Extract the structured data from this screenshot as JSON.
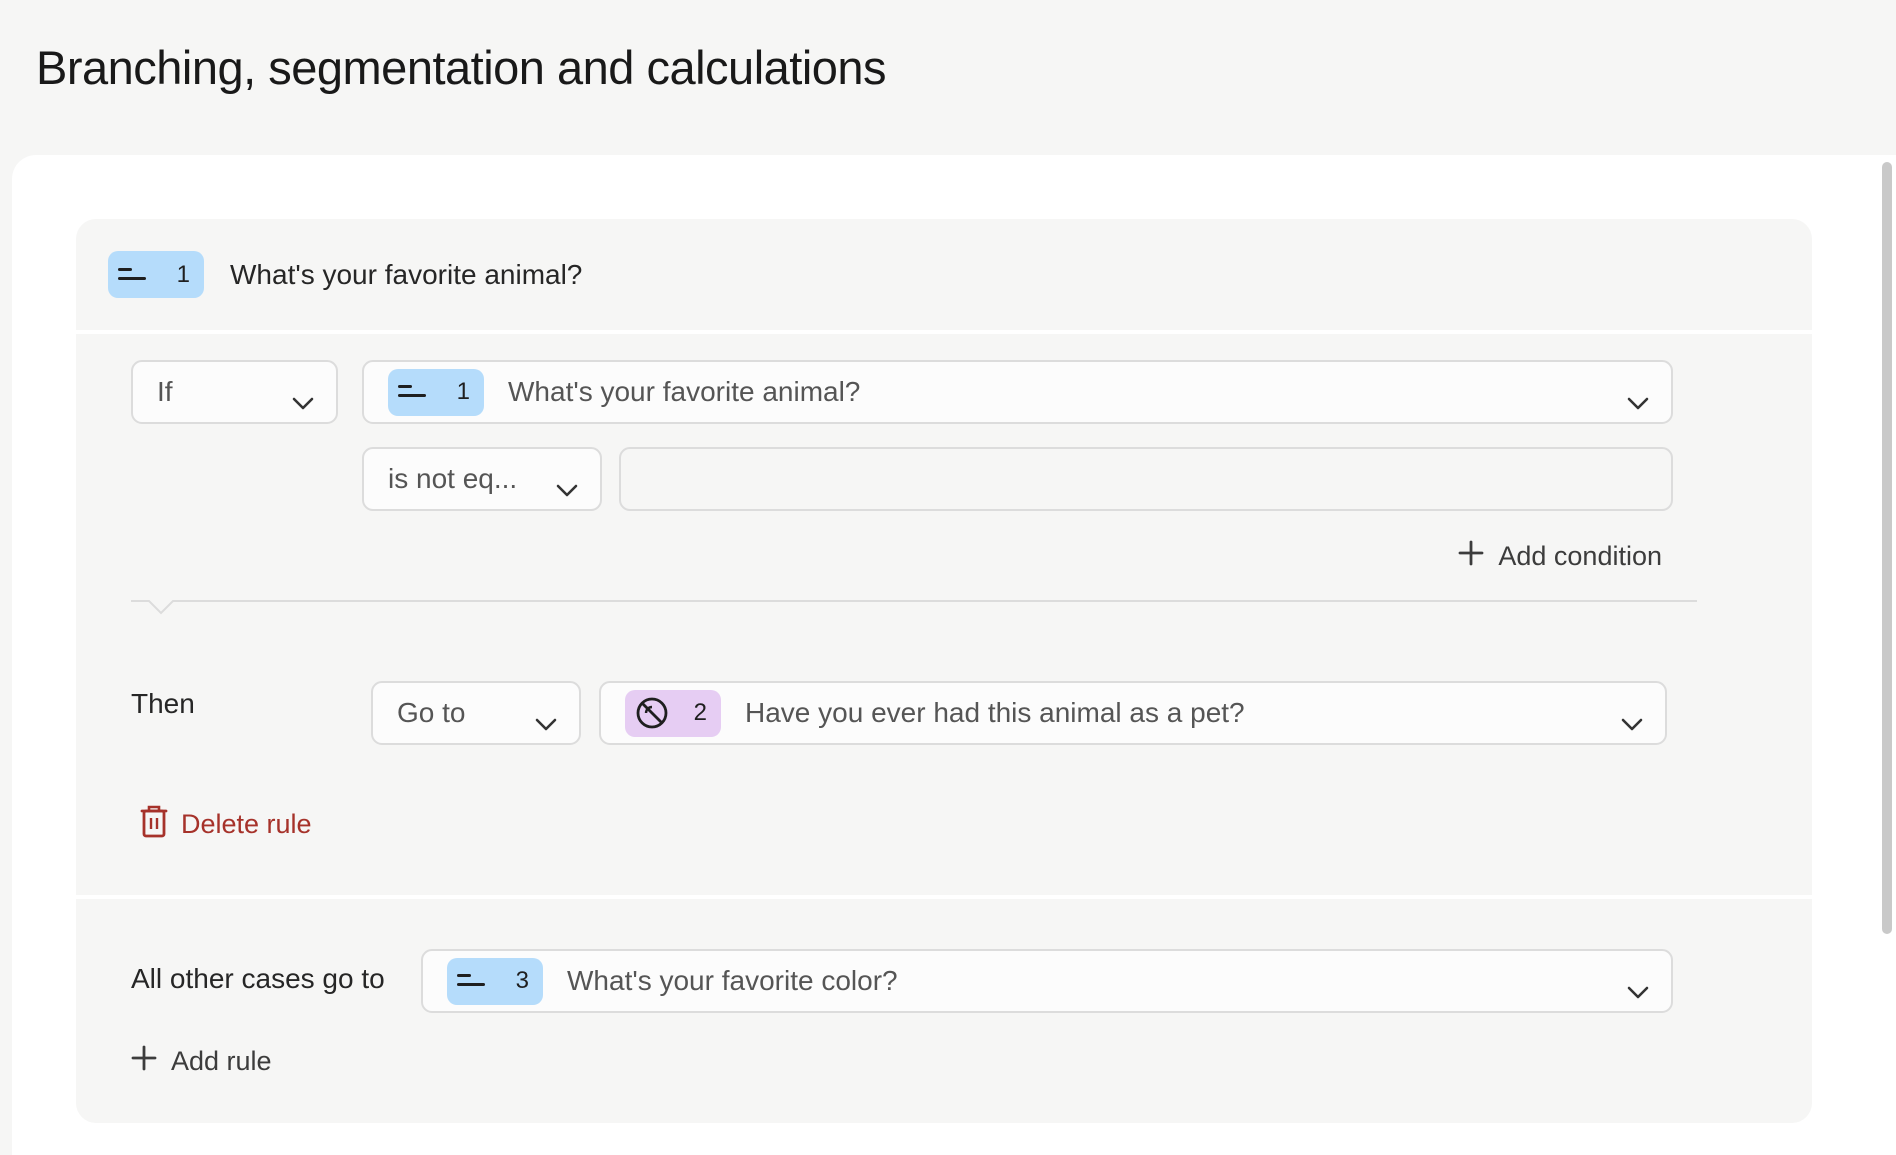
{
  "page": {
    "title": "Branching, segmentation and calculations"
  },
  "question_block": {
    "number": "1",
    "title": "What's your favorite animal?",
    "rule": {
      "if_label": "If",
      "question": {
        "number": "1",
        "title": "What's your favorite animal?"
      },
      "operator": "is not eq...",
      "value": "",
      "add_condition": "Add condition",
      "then_label": "Then",
      "action": "Go to",
      "target": {
        "number": "2",
        "title": "Have you ever had this animal as a pet?"
      },
      "delete_rule": "Delete rule"
    },
    "fallback": {
      "label": "All other cases go to",
      "target": {
        "number": "3",
        "title": "What's your favorite color?"
      },
      "add_rule": "Add rule"
    }
  },
  "colors": {
    "badge_blue": "#b5dcfb",
    "badge_purple": "#e6cdf3",
    "delete_red": "#a6322a",
    "block_bg": "#f6f6f5"
  },
  "icons": {
    "short_text": "short-text-icon",
    "yes_no": "prohibited-circle-icon",
    "chevron": "chevron-down-icon",
    "plus": "plus-icon",
    "trash": "trash-icon"
  }
}
